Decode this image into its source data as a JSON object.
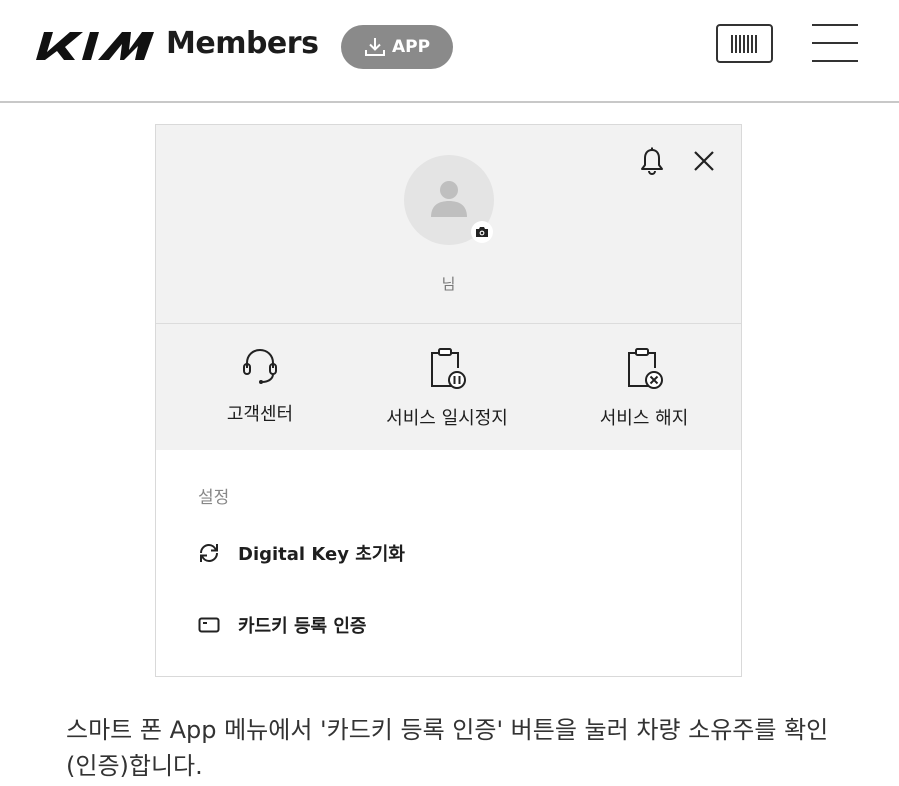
{
  "header": {
    "brand_text": "Members",
    "app_badge_label": "APP",
    "icons": {
      "logo": "kia-logo",
      "download": "download-icon",
      "barcode": "barcode-icon",
      "menu": "hamburger-menu-icon"
    }
  },
  "panel": {
    "profile": {
      "username": "님",
      "icons": {
        "bell": "bell-icon",
        "close": "close-icon",
        "avatar": "user-avatar-icon",
        "camera": "camera-icon"
      }
    },
    "services": [
      {
        "label": "고객센터",
        "icon": "headset-icon"
      },
      {
        "label": "서비스 일시정지",
        "icon": "clipboard-pause-icon"
      },
      {
        "label": "서비스 해지",
        "icon": "clipboard-cancel-icon"
      }
    ],
    "settings": {
      "title": "설정",
      "items": [
        {
          "label": "Digital Key 초기화",
          "icon": "refresh-icon"
        },
        {
          "label": "카드키 등록 인증",
          "icon": "card-icon"
        }
      ]
    }
  },
  "description": "스마트 폰 App 메뉴에서 '카드키 등록 인증' 버튼을 눌러 차량 소유주를 확인(인증)합니다.",
  "colors": {
    "badge_bg": "#8a8a8a",
    "panel_gray": "#f2f2f2",
    "text_dark": "#1e1e1e",
    "text_muted": "#888888"
  }
}
